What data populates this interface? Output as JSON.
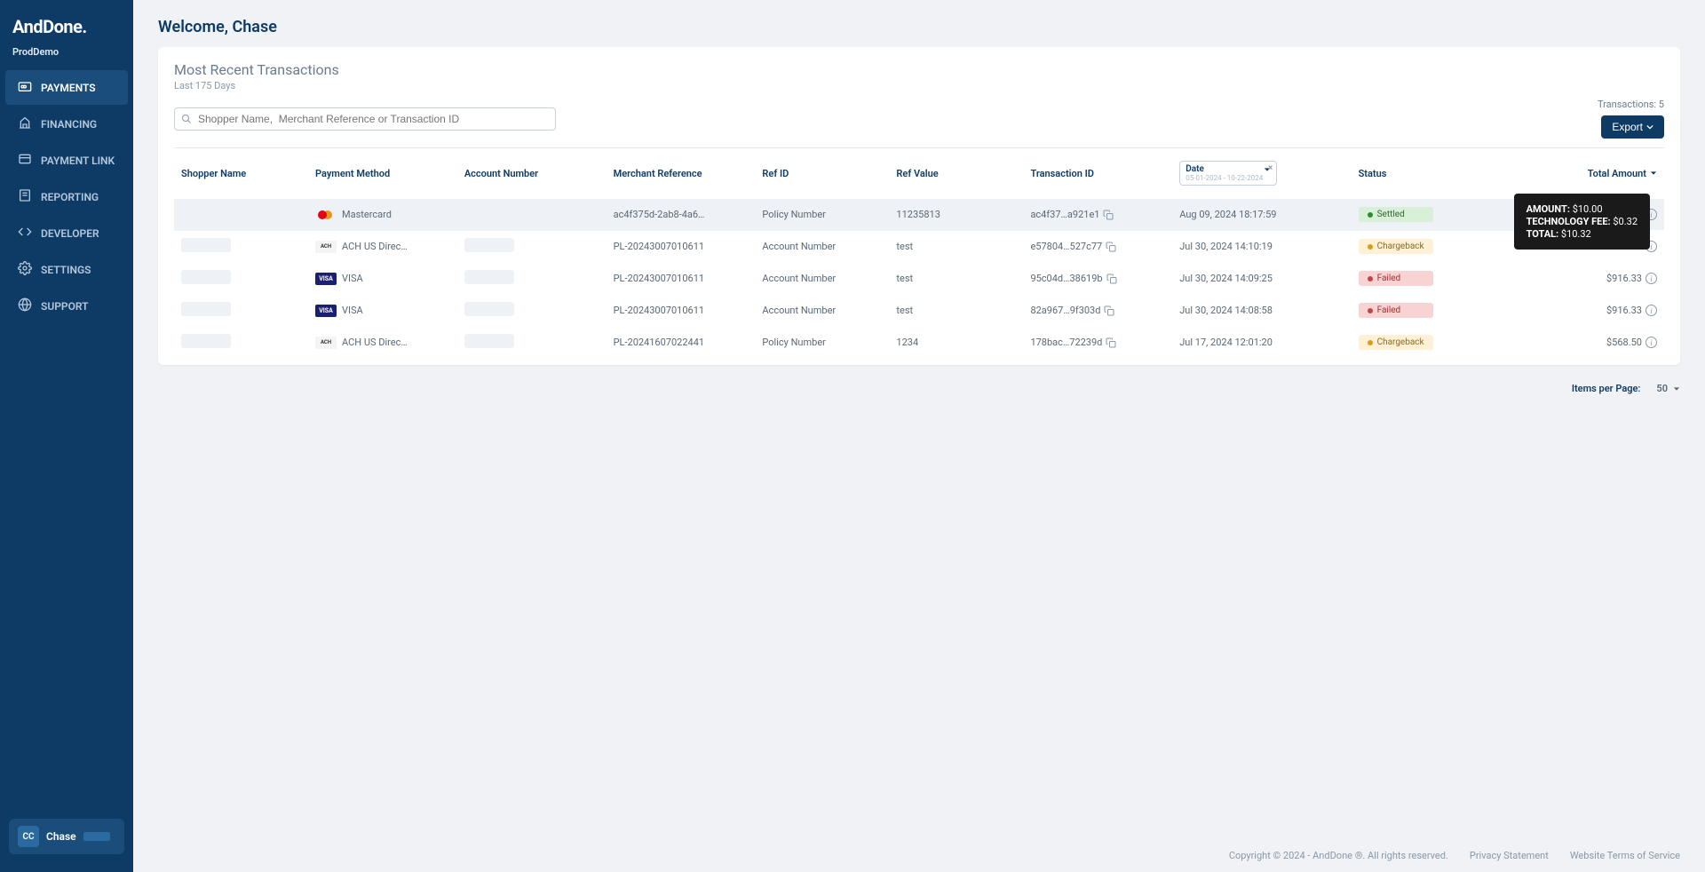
{
  "brand": "AndDone.",
  "env": "ProdDemo",
  "nav": [
    {
      "label": "PAYMENTS",
      "active": true,
      "icon": "payments"
    },
    {
      "label": "FINANCING",
      "active": false,
      "icon": "financing"
    },
    {
      "label": "PAYMENT LINK",
      "active": false,
      "icon": "link"
    },
    {
      "label": "REPORTING",
      "active": false,
      "icon": "report"
    },
    {
      "label": "DEVELOPER",
      "active": false,
      "icon": "code"
    },
    {
      "label": "SETTINGS",
      "active": false,
      "icon": "gear"
    },
    {
      "label": "SUPPORT",
      "active": false,
      "icon": "globe"
    }
  ],
  "user": {
    "initials": "CC",
    "name": "Chase"
  },
  "page": {
    "welcome": "Welcome, Chase",
    "section_title": "Most Recent Transactions",
    "section_sub": "Last 175 Days",
    "search_placeholder": "Shopper Name,  Merchant Reference or Transaction ID",
    "tx_count_label": "Transactions: 5",
    "export_label": "Export"
  },
  "columns": {
    "shopper": "Shopper Name",
    "payment_method": "Payment Method",
    "account_number": "Account Number",
    "merchant_ref": "Merchant Reference",
    "ref_id": "Ref ID",
    "ref_value": "Ref Value",
    "transaction_id": "Transaction ID",
    "date": "Date",
    "date_range": "05-01-2024 - 10-22-2024",
    "status": "Status",
    "total_amount": "Total Amount"
  },
  "rows": [
    {
      "pm": "Mastercard",
      "pm_type": "mc",
      "merchant_ref": "ac4f375d-2ab8-4a6…",
      "ref_id": "Policy Number",
      "ref_value": "11235813",
      "txid": "ac4f37…a921e1",
      "date": "Aug 09, 2024 18:17:59",
      "status": "Settled",
      "status_class": "settled",
      "amount": ""
    },
    {
      "pm": "ACH US Direc…",
      "pm_type": "ach",
      "merchant_ref": "PL-20243007010611",
      "ref_id": "Account Number",
      "ref_value": "test",
      "txid": "e57804…527c77",
      "date": "Jul 30, 2024 14:10:19",
      "status": "Chargeback",
      "status_class": "chargeback",
      "amount": ""
    },
    {
      "pm": "VISA",
      "pm_type": "visa",
      "merchant_ref": "PL-20243007010611",
      "ref_id": "Account Number",
      "ref_value": "test",
      "txid": "95c04d…38619b",
      "date": "Jul 30, 2024 14:09:25",
      "status": "Failed",
      "status_class": "failed",
      "amount": "$916.33"
    },
    {
      "pm": "VISA",
      "pm_type": "visa",
      "merchant_ref": "PL-20243007010611",
      "ref_id": "Account Number",
      "ref_value": "test",
      "txid": "82a967…9f303d",
      "date": "Jul 30, 2024 14:08:58",
      "status": "Failed",
      "status_class": "failed",
      "amount": "$916.33"
    },
    {
      "pm": "ACH US Direc…",
      "pm_type": "ach",
      "merchant_ref": "PL-20241607022441",
      "ref_id": "Policy Number",
      "ref_value": "1234",
      "txid": "178bac…72239d",
      "date": "Jul 17, 2024 12:01:20",
      "status": "Chargeback",
      "status_class": "chargeback",
      "amount": "$568.50"
    }
  ],
  "tooltip": {
    "amount_label": "AMOUNT:",
    "amount": "$10.00",
    "tech_fee_label": "TECHNOLOGY FEE:",
    "tech_fee": "$0.32",
    "total_label": "TOTAL:",
    "total": "$10.32"
  },
  "pager": {
    "items_label": "Items per Page:",
    "items_value": "50"
  },
  "footer": {
    "copyright": "Copyright © 2024 - AndDone ®. All rights reserved.",
    "privacy": "Privacy Statement",
    "terms": "Website Terms of Service"
  }
}
